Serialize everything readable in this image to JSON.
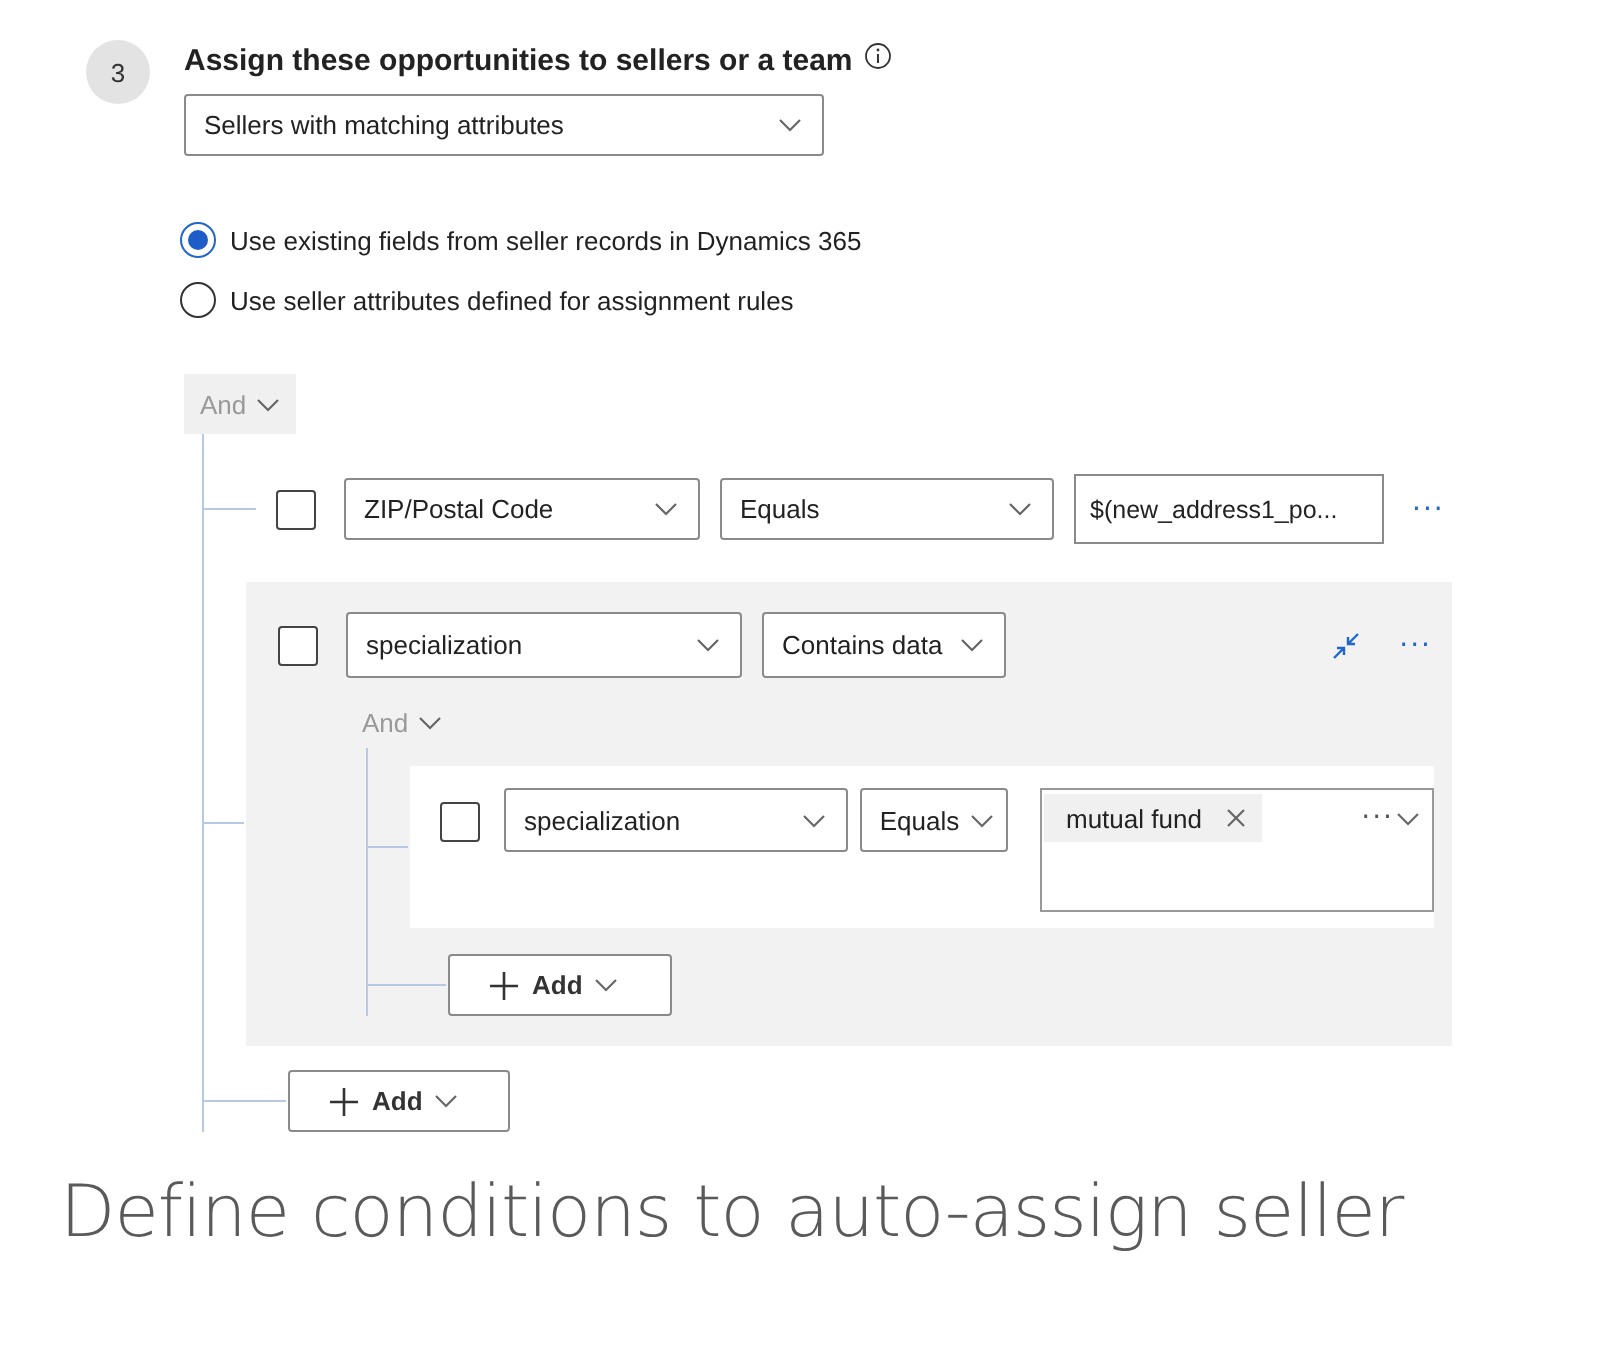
{
  "step": {
    "number": "3",
    "title": "Assign these opportunities to sellers or a team"
  },
  "assign_dropdown": {
    "value": "Sellers with matching attributes"
  },
  "options": [
    {
      "label": "Use existing fields from seller records in Dynamics 365",
      "selected": true
    },
    {
      "label": "Use seller attributes defined for assignment rules",
      "selected": false
    }
  ],
  "conditions": {
    "operator": "And",
    "items": [
      {
        "kind": "condition",
        "checked": false,
        "field": "ZIP/Postal Code",
        "operator": "Equals",
        "value": "$(new_address1_po...",
        "more": "···"
      },
      {
        "kind": "group",
        "checked": false,
        "field": "specialization",
        "operator": "Contains data",
        "more": "···",
        "conditions": {
          "operator": "And",
          "items": [
            {
              "kind": "tags",
              "checked": false,
              "field": "specialization",
              "operator": "Equals",
              "tags": [
                "mutual fund"
              ],
              "more": "···"
            }
          ],
          "add_label": "Add"
        }
      }
    ],
    "add_label": "Add"
  },
  "caption": "Define conditions to auto-assign seller"
}
